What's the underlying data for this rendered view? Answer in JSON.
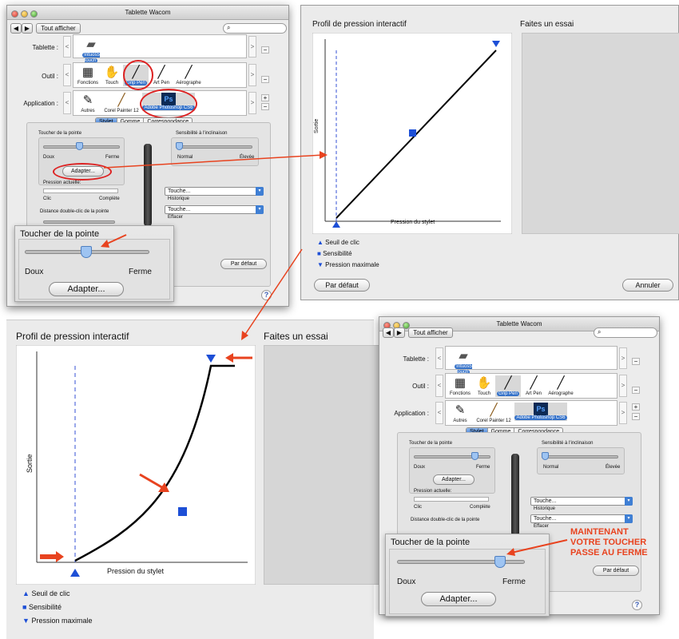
{
  "win1": {
    "title": "Tablette Wacom",
    "show_all": "Tout afficher",
    "nav_back": "◀",
    "nav_fwd": "▶",
    "search_placeholder": "",
    "row_tablet": "Tablette :",
    "row_tool": "Outil :",
    "row_app": "Application :",
    "tablet_name": "Intuos5 touch",
    "tools": [
      "Fonctions",
      "Touch",
      "Grip Pen",
      "Art Pen",
      "Aérographe"
    ],
    "apps": [
      "Autres",
      "Corel Painter 12",
      "Adobe Photoshop CS6"
    ],
    "tabs": [
      "Stylet",
      "Gomme",
      "Correspondance"
    ],
    "tip_feel": "Toucher de la pointe",
    "soft": "Doux",
    "firm": "Ferme",
    "customize": "Adapter...",
    "current_pressure": "Pression actuelle:",
    "click": "Clic",
    "full": "Complète",
    "tilt": "Sensibilité à l'inclinaison",
    "normal": "Normal",
    "high": "Élevée",
    "btn1": "Touche...",
    "btn1_sub": "Historique",
    "btn2": "Touche...",
    "btn2_sub": "Effacer",
    "dblclick": "Distance double-clic de la pointe",
    "default": "Par défaut",
    "help": "?"
  },
  "zoom1": {
    "title": "Toucher de la pointe",
    "soft": "Doux",
    "firm": "Ferme",
    "customize": "Adapter..."
  },
  "win2": {
    "profile_title": "Profil de pression interactif",
    "try_title": "Faites un essai",
    "ylabel": "Sortie",
    "xlabel": "Pression du stylet",
    "legend": [
      "Seuil de clic",
      "Sensibilité",
      "Pression maximale"
    ],
    "default": "Par défaut",
    "cancel": "Annuler"
  },
  "big": {
    "profile_title": "Profil de pression interactif",
    "try_title": "Faites un essai",
    "ylabel": "Sortie",
    "xlabel": "Pression du stylet",
    "legend": [
      "Seuil de clic",
      "Sensibilité",
      "Pression maximale"
    ]
  },
  "win3": {
    "title": "Tablette Wacom",
    "show_all": "Tout afficher",
    "row_tablet": "Tablette :",
    "row_tool": "Outil :",
    "row_app": "Application :",
    "tablet_name": "Intuos5 touch",
    "tools": [
      "Fonctions",
      "Touch",
      "Grip Pen",
      "Art Pen",
      "Aérographe"
    ],
    "apps": [
      "Autres",
      "Corel Painter 12",
      "Adobe Photoshop CS6"
    ],
    "tabs": [
      "Stylet",
      "Gomme",
      "Correspondance"
    ],
    "tip_feel": "Toucher de la pointe",
    "soft": "Doux",
    "firm": "Ferme",
    "customize": "Adapter...",
    "current_pressure": "Pression actuelle:",
    "click": "Clic",
    "full": "Complète",
    "tilt": "Sensibilité à l'inclinaison",
    "normal": "Normal",
    "high": "Élevée",
    "btn1": "Touche...",
    "btn1_sub": "Historique",
    "btn2": "Touche...",
    "btn2_sub": "Effacer",
    "dblclick": "Distance double-clic de la pointe",
    "default": "Par défaut",
    "help": "?"
  },
  "zoom2": {
    "title": "Toucher de la pointe",
    "soft": "Doux",
    "firm": "Ferme",
    "customize": "Adapter..."
  },
  "annotation": [
    "Maintenant",
    "votre toucher",
    "passe au ferme"
  ],
  "colors": {
    "accent": "#2f62d6",
    "highlight": "#3572c9",
    "red": "#e8431f"
  }
}
